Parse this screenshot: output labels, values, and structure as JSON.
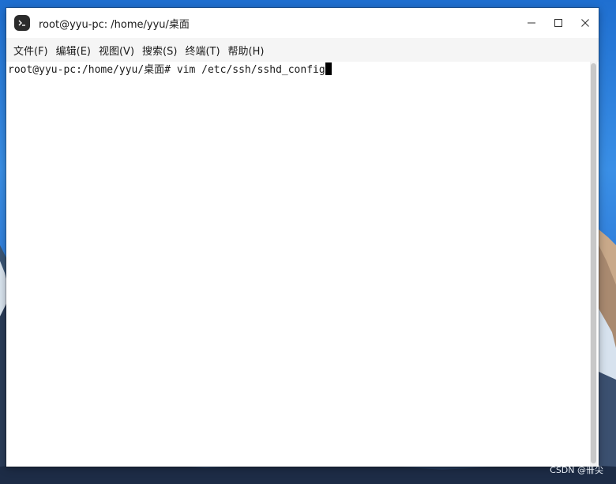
{
  "window": {
    "title": "root@yyu-pc: /home/yyu/桌面"
  },
  "menu": {
    "items": [
      "文件(F)",
      "编辑(E)",
      "视图(V)",
      "搜索(S)",
      "终端(T)",
      "帮助(H)"
    ]
  },
  "terminal": {
    "prompt": "root@yyu-pc:/home/yyu/桌面#",
    "command": " vim /etc/ssh/sshd_config"
  },
  "watermark": {
    "text": "CSDN @卌尖"
  },
  "colors": {
    "desktop_top": "#1f6fd0",
    "desktop_bottom": "#1c2e4a",
    "window_bg": "#ffffff",
    "menubar_bg": "#f5f5f5",
    "cursor": "#000000"
  },
  "icons": {
    "app": "terminal-icon",
    "minimize": "minimize-icon",
    "maximize": "maximize-icon",
    "close": "close-icon"
  }
}
